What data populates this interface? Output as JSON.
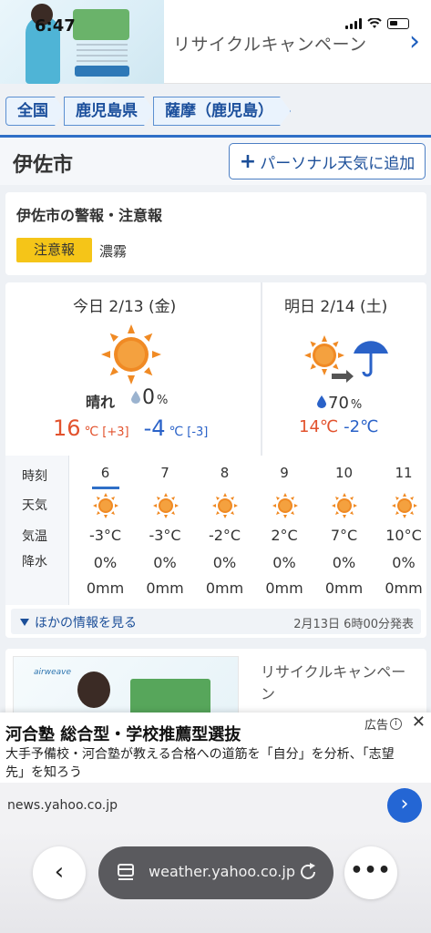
{
  "status_bar": {
    "time": "6:47"
  },
  "top_ad": {
    "title": "リサイクルキャンペーン"
  },
  "breadcrumb": [
    "全国",
    "鹿児島県",
    "薩摩（鹿児島）"
  ],
  "city": {
    "name": "伊佐市",
    "add_button": "パーソナル天気に追加"
  },
  "warnings": {
    "title": "伊佐市の警報・注意報",
    "badge": "注意報",
    "text": "濃霧"
  },
  "today": {
    "label": "今日  2/13 (金)",
    "icon": "sun-icon",
    "weather": "晴れ",
    "precip": "0",
    "precip_unit": "%",
    "high": "16",
    "high_diff": "[+3]",
    "low": "-4",
    "low_diff": "[-3]",
    "unit": "℃"
  },
  "tomorrow": {
    "label": "明日  2/14 (土)",
    "icon": "sun-then-rain-icon",
    "precip": "70",
    "precip_unit": "%",
    "high": "14",
    "low": "-2",
    "unit": "℃"
  },
  "hourly": {
    "labels": {
      "time": "時刻",
      "weather": "天気",
      "temp": "気温",
      "precip": "降水"
    },
    "hours": [
      {
        "hour": "6",
        "temp": "-3°C",
        "pop": "0%",
        "rain": "0mm"
      },
      {
        "hour": "7",
        "temp": "-3°C",
        "pop": "0%",
        "rain": "0mm"
      },
      {
        "hour": "8",
        "temp": "-2°C",
        "pop": "0%",
        "rain": "0mm"
      },
      {
        "hour": "9",
        "temp": "2°C",
        "pop": "0%",
        "rain": "0mm"
      },
      {
        "hour": "10",
        "temp": "7°C",
        "pop": "0%",
        "rain": "0mm"
      },
      {
        "hour": "11",
        "temp": "10°C",
        "pop": "0%",
        "rain": "0mm"
      }
    ]
  },
  "more_info": {
    "label": "ほかの情報を見る",
    "issued": "2月13日 6時00分発表"
  },
  "ad2": {
    "brand": "airweave",
    "title": "リサイクルキャンペーン"
  },
  "sticky_ad": {
    "headline": "河合塾 総合型・学校推薦型選抜",
    "body": "大手予備校・河合塾が教える合格への道筋を「自分」を分析、「志望先」を知ろう",
    "ad_label": "広告"
  },
  "source": {
    "url": "news.yahoo.co.jp"
  },
  "browser": {
    "url": "weather.yahoo.co.jp"
  },
  "colors": {
    "accent": "#2f6fc7",
    "high_temp": "#e2522d",
    "low_temp": "#2a62c8",
    "warning": "#f5c518",
    "sun": "#f08a24"
  }
}
